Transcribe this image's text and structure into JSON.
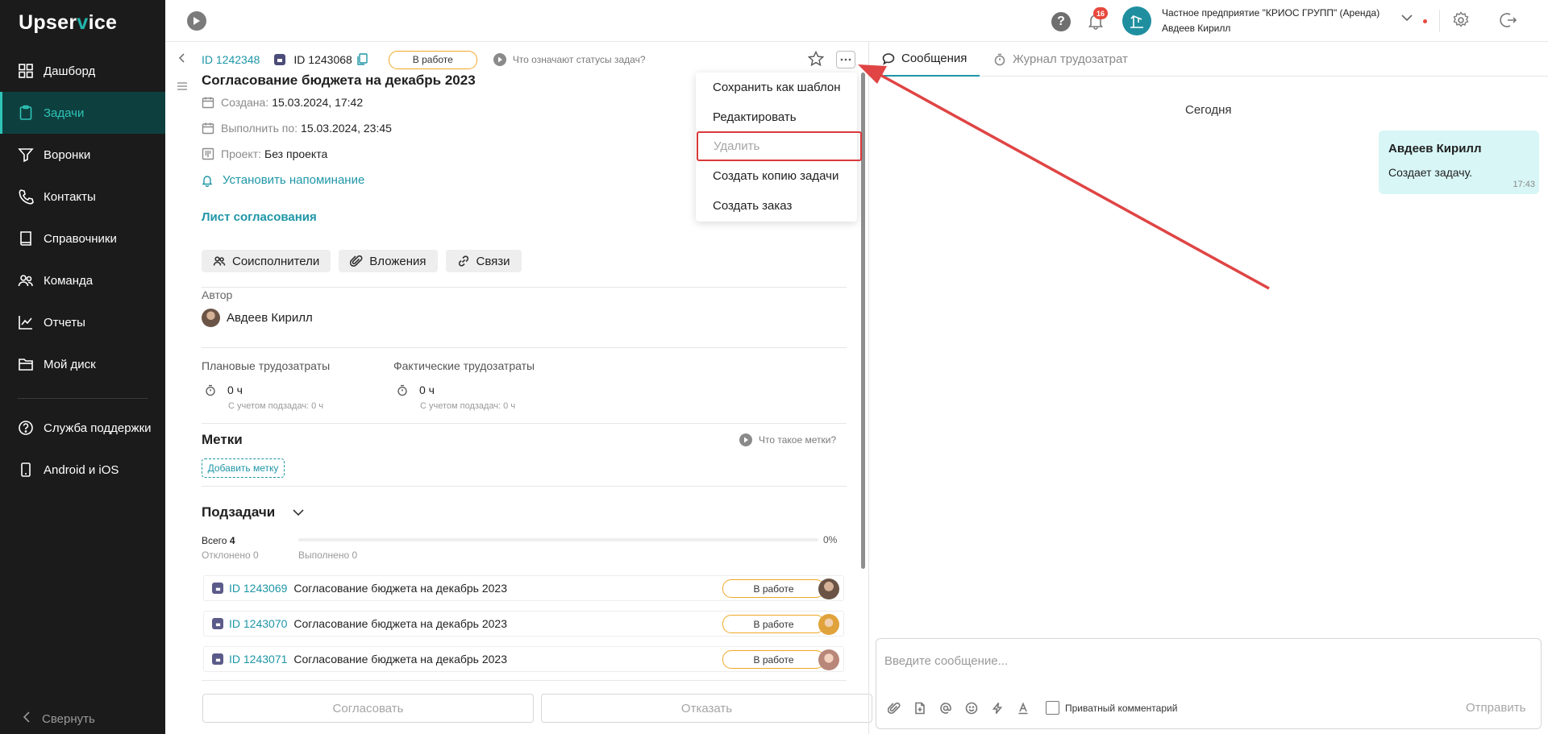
{
  "app": {
    "logo_prefix": "Upser",
    "logo_v": "v",
    "logo_suffix": "ice"
  },
  "sidebar": {
    "items": [
      {
        "label": "Дашборд",
        "icon": "dashboard-icon"
      },
      {
        "label": "Задачи",
        "icon": "tasks-icon",
        "active": true
      },
      {
        "label": "Воронки",
        "icon": "funnel-icon"
      },
      {
        "label": "Контакты",
        "icon": "phone-icon"
      },
      {
        "label": "Справочники",
        "icon": "book-icon"
      },
      {
        "label": "Команда",
        "icon": "team-icon"
      },
      {
        "label": "Отчеты",
        "icon": "chart-icon"
      },
      {
        "label": "Мой диск",
        "icon": "folder-icon"
      }
    ],
    "bottom_items": [
      {
        "label": "Служба поддержки",
        "icon": "help-icon"
      },
      {
        "label": "Android и iOS",
        "icon": "mobile-icon"
      }
    ],
    "collapse_label": "Свернуть"
  },
  "topbar": {
    "notifications_count": "16",
    "org_name": "Частное предприятие \"КРИОС ГРУПП\" (Аренда)",
    "user_name": "Авдеев Кирилл",
    "accent": "#1e96a6"
  },
  "task": {
    "parent_id": "ID 1242348",
    "id": "ID 1243068",
    "status": "В работе",
    "status_help": "Что означают статусы задач?",
    "title": "Согласование бюджета на декабрь 2023",
    "created_label": "Создана:",
    "created_value": "15.03.2024, 17:42",
    "due_label": "Выполнить по:",
    "due_value": "15.03.2024, 23:45",
    "project_label": "Проект:",
    "project_value": "Без проекта",
    "reminder": "Установить напоминание",
    "approval_sheet": "Лист согласования",
    "chips": {
      "coexec": "Соисполнители",
      "attachments": "Вложения",
      "links": "Связи"
    },
    "author_label": "Автор",
    "author_name": "Авдеев Кирилл",
    "planned_label": "Плановые трудозатраты",
    "planned_value": "0 ч",
    "planned_sub": "С учетом подзадач: 0 ч",
    "actual_label": "Фактические трудозатраты",
    "actual_value": "0 ч",
    "actual_sub": "С учетом подзадач: 0 ч",
    "labels_title": "Метки",
    "labels_help": "Что такое метки?",
    "add_label": "Добавить метку",
    "subtasks_title": "Подзадачи",
    "total_label": "Всего",
    "total_value": "4",
    "rejected": "Отклонено 0",
    "done": "Выполнено 0",
    "progress_text": "0%",
    "progress": 0,
    "subtasks": [
      {
        "id": "ID 1243069",
        "title": "Согласование бюджета на декабрь 2023",
        "status": "В работе"
      },
      {
        "id": "ID 1243070",
        "title": "Согласование бюджета на декабрь 2023",
        "status": "В работе"
      },
      {
        "id": "ID 1243071",
        "title": "Согласование бюджета на декабрь 2023",
        "status": "В работе"
      }
    ],
    "approve_btn": "Согласовать",
    "reject_btn": "Отказать"
  },
  "menu": {
    "items": [
      "Сохранить как шаблон",
      "Редактировать",
      "Удалить",
      "Создать копию задачи",
      "Создать заказ"
    ],
    "highlight_color": "#d9393a"
  },
  "chat": {
    "tab_messages": "Сообщения",
    "tab_journal": "Журнал трудозатрат",
    "day": "Сегодня",
    "messages": [
      {
        "author": "Авдеев Кирилл",
        "text": "Создает задачу.",
        "time": "17:43"
      }
    ],
    "placeholder": "Введите сообщение...",
    "private_label": "Приватный комментарий",
    "send": "Отправить"
  }
}
